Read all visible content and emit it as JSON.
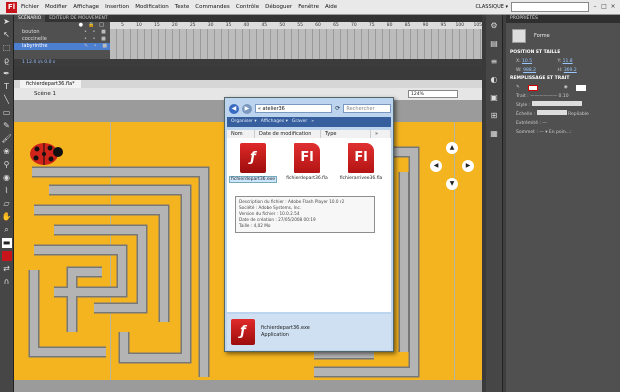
{
  "menubar": {
    "logo": "Fl",
    "items": [
      "Fichier",
      "Modifier",
      "Affichage",
      "Insertion",
      "Modification",
      "Texte",
      "Commandes",
      "Contrôle",
      "Déboguer",
      "Fenêtre",
      "Aide"
    ],
    "workspace": "CLASSIQUE ▾",
    "window_controls": [
      "–",
      "□",
      "×"
    ]
  },
  "timeline": {
    "tabs": [
      "SCÉNARIO",
      "EDITEUR DE MOUVEMENT"
    ],
    "layers": [
      {
        "name": "bouton"
      },
      {
        "name": "coccinelle"
      },
      {
        "name": "labyrinthe"
      }
    ],
    "frame_numbers": [
      "5",
      "10",
      "15",
      "20",
      "25",
      "30",
      "35",
      "40",
      "45",
      "50",
      "55",
      "60",
      "65",
      "70",
      "75",
      "80",
      "85",
      "90",
      "95",
      "100",
      "105"
    ],
    "status": "1    12.0 i/s    0.0 s",
    "status_values": {
      "frame": "1",
      "fps": "12.0 i/s",
      "time": "0.0 s"
    }
  },
  "document": {
    "tab": "fichierdepart36.fla*",
    "scene": "Scène 1",
    "zoom": "124%"
  },
  "properties": {
    "header": "PROPRIÉTÉS",
    "type": "Forme",
    "section_position": "POSITION ET TAILLE",
    "x_label": "X:",
    "x": "10.5",
    "y_label": "Y:",
    "y": "11.8",
    "w_label": "W:",
    "w": "988.2",
    "h_label": "H:",
    "h": "369.2",
    "section_fill": "REMPLISSAGE ET TRAIT",
    "trait_label": "Trait :",
    "trait_value": "0.10",
    "style_label": "Style :",
    "echelle_label": "Échelle :",
    "repliable": "Repliable",
    "extremite": "Extrémité : —",
    "sommet": "Sommet : — ▾  En poin...:"
  },
  "explorer": {
    "address": "« atelier36",
    "search_placeholder": "Rechercher",
    "toolbar": [
      "Organiser ▾",
      "Affichages ▾",
      "Graver",
      "»"
    ],
    "columns": [
      "Nom",
      "Date de modification",
      "Type",
      "»"
    ],
    "files": [
      {
        "name": "fichierdepart36.exe",
        "icon": "flash-player-icon",
        "glyph": "ƒ"
      },
      {
        "name": "fichierdepart36.fla",
        "icon": "fla-file-icon",
        "glyph": "Fl"
      },
      {
        "name": "fichierarrivee36.fla",
        "icon": "fla-file-icon",
        "glyph": "Fl"
      }
    ],
    "tooltip": [
      "Description du fichier : Adobe Flash Player 10.0 r2",
      "Société : Adobe Systems, Inc.",
      "Version du fichier : 10.0.2.54",
      "Date de création : 27/05/2008 00:19",
      "Taille : 4,02 Mo"
    ],
    "status_name": "fichierdepart36.exe",
    "status_type": "Application"
  },
  "colors": {
    "stage": "#f4b420",
    "maze": "#a8a8a8",
    "selection": "#4d7fd1",
    "flash_red": "#c8141b"
  }
}
